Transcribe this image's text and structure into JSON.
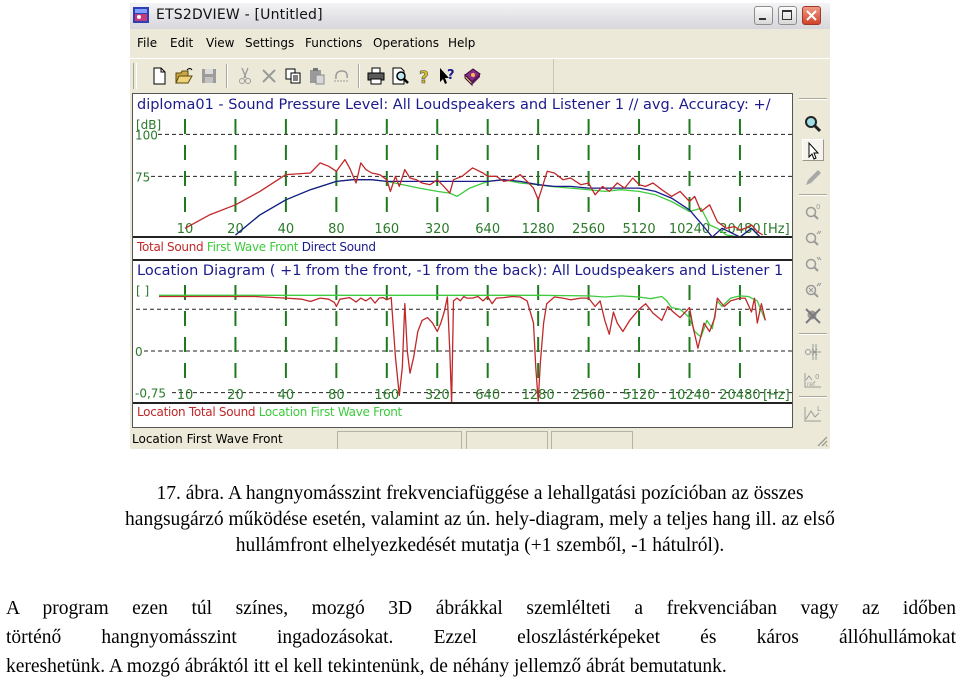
{
  "window": {
    "title": "ETS2DVIEW - [Untitled]",
    "icon": "ets-app-icon",
    "controls": [
      "minimize",
      "maximize",
      "close"
    ]
  },
  "menu": {
    "items": [
      "File",
      "Edit",
      "View",
      "Settings",
      "Functions",
      "Operations",
      "Help"
    ]
  },
  "toolbar": {
    "buttons": [
      {
        "name": "new",
        "icon": "new-document-icon",
        "enabled": true
      },
      {
        "name": "open",
        "icon": "open-folder-icon",
        "enabled": true
      },
      {
        "name": "save",
        "icon": "save-disk-icon",
        "enabled": false
      },
      {
        "name": "cut",
        "icon": "scissors-icon",
        "enabled": false
      },
      {
        "name": "delete",
        "icon": "x-delete-icon",
        "enabled": false
      },
      {
        "name": "copy",
        "icon": "copy-icon",
        "enabled": true
      },
      {
        "name": "paste",
        "icon": "paste-icon",
        "enabled": false
      },
      {
        "name": "undo",
        "icon": "undo-icon",
        "enabled": false
      },
      {
        "name": "print",
        "icon": "printer-icon",
        "enabled": true
      },
      {
        "name": "print-preview",
        "icon": "print-preview-icon",
        "enabled": true
      },
      {
        "name": "help",
        "icon": "question-mark-icon",
        "enabled": true
      },
      {
        "name": "context-help",
        "icon": "whats-this-icon",
        "enabled": true
      },
      {
        "name": "book",
        "icon": "book-icon",
        "enabled": true
      }
    ]
  },
  "colors": {
    "total_sound": "#c0282a",
    "first_wave_front": "#3ecb3e",
    "direct_sound": "#1a1a8c",
    "grid": "#1f7a1f",
    "title_text": "#1b1b8c",
    "axis_text": "#2a7a2a"
  },
  "chart_data": [
    {
      "type": "line",
      "title": "diploma01 - Sound Pressure Level:  All Loudspeakers and Listener 1 // avg. Accuracy: +/",
      "ylabel": "[dB]",
      "xlabel": "[Hz]",
      "x_scale": "log2",
      "xlim": [
        7,
        30000
      ],
      "ylim": [
        40,
        108
      ],
      "yticks": [
        {
          "value": 100,
          "label": "100"
        },
        {
          "value": 75,
          "label": "75"
        }
      ],
      "xticks": [
        10,
        20,
        40,
        80,
        160,
        320,
        640,
        1280,
        2560,
        5120,
        10240,
        20480
      ],
      "xtick_labels": [
        "10",
        "20",
        "40",
        "80",
        "160",
        "320",
        "640",
        "1280",
        "2560",
        "5120",
        "10240",
        "20480"
      ],
      "grid": true,
      "legend": [
        "Total Sound",
        "First Wave Front",
        "Direct Sound"
      ],
      "legend_placement": "bottom-left",
      "series": [
        {
          "name": "Total Sound",
          "x": [
            10,
            14,
            20,
            28,
            40,
            56,
            64,
            72,
            80,
            90,
            96,
            105,
            112,
            120,
            130,
            145,
            160,
            168,
            180,
            190,
            205,
            220,
            240,
            260,
            290,
            320,
            350,
            380,
            400,
            450,
            520,
            600,
            640,
            720,
            800,
            900,
            1000,
            1100,
            1200,
            1280,
            1350,
            1450,
            1600,
            1800,
            2000,
            2300,
            2560,
            2800,
            3100,
            3400,
            3800,
            4200,
            4700,
            5120,
            5600,
            6200,
            7000,
            8000,
            9000,
            10240,
            11000,
            12000,
            13500,
            15000,
            17000,
            19000,
            20480,
            22000,
            24000,
            26000,
            28000
          ],
          "y": [
            44,
            52,
            58,
            66,
            76,
            77,
            83,
            81,
            78,
            85,
            80,
            71,
            83,
            79,
            77,
            76,
            73,
            66,
            75,
            69,
            79,
            74,
            73,
            71,
            70,
            73,
            69,
            65,
            73,
            75,
            80,
            77,
            75,
            75,
            72,
            73,
            76,
            72,
            68,
            61,
            68,
            78,
            77,
            73,
            74,
            70,
            71,
            64,
            69,
            66,
            71,
            68,
            74,
            70,
            69,
            71,
            67,
            63,
            66,
            60,
            63,
            54,
            58,
            48,
            44,
            45,
            43,
            44,
            46,
            42,
            40
          ]
        },
        {
          "name": "First Wave Front",
          "x": [
            20,
            28,
            40,
            56,
            80,
            100,
            130,
            160,
            200,
            250,
            320,
            380,
            420,
            500,
            640,
            800,
            1000,
            1280,
            1500,
            2000,
            2560,
            3200,
            4000,
            5120,
            6400,
            8000,
            10240,
            12000,
            13500,
            15000,
            17000,
            20480,
            24000,
            27000
          ],
          "y": [
            40,
            52,
            61,
            67,
            72,
            73,
            73,
            72,
            70,
            68,
            66,
            65,
            63,
            68,
            72,
            73,
            71,
            70,
            69,
            68,
            67,
            66,
            67,
            66,
            64,
            60,
            54,
            56,
            46,
            44,
            40,
            38,
            44,
            38
          ]
        },
        {
          "name": "Direct Sound",
          "x": [
            20,
            28,
            40,
            56,
            80,
            100,
            130,
            160,
            250,
            320,
            500,
            640,
            800,
            1000,
            1280,
            1600,
            2000,
            2560,
            3200,
            4000,
            5120,
            6400,
            8000,
            10240,
            12000,
            14000,
            16000,
            20480,
            24000,
            27000
          ],
          "y": [
            40,
            52,
            61,
            67,
            72,
            73,
            73,
            72,
            72,
            72,
            72,
            72,
            73,
            72,
            70,
            69,
            69,
            68,
            68,
            68,
            68,
            66,
            62,
            55,
            47,
            38,
            44,
            36,
            44,
            38
          ]
        }
      ]
    },
    {
      "type": "line",
      "title": "Location Diagram ( +1 from the front, -1 from the back):  All Loudspeakers and Listener 1",
      "ylabel": "[ ]",
      "xlabel": "[Hz]",
      "x_scale": "log2",
      "xlim": [
        7,
        30000
      ],
      "ylim": [
        -0.9,
        1.15
      ],
      "yticks": [
        {
          "value": 0.75,
          "label": ""
        },
        {
          "value": 0,
          "label": "0"
        },
        {
          "value": -0.75,
          "label": "-0,75"
        }
      ],
      "xticks": [
        10,
        20,
        40,
        80,
        160,
        320,
        640,
        1280,
        2560,
        5120,
        10240,
        20480
      ],
      "xtick_labels": [
        "10",
        "20",
        "40",
        "80",
        "160",
        "320",
        "640",
        "1280",
        "2560",
        "5120",
        "10240",
        "20480"
      ],
      "grid": true,
      "legend": [
        "Location Total Sound",
        "Location First Wave Front"
      ],
      "legend_placement": "bottom-left",
      "series": [
        {
          "name": "Location Total Sound",
          "x": [
            7,
            26,
            40,
            50,
            56,
            64,
            72,
            78,
            80,
            84,
            96,
            105,
            112,
            120,
            128,
            136,
            144,
            152,
            160,
            170,
            180,
            190,
            198,
            205,
            212,
            220,
            232,
            245,
            260,
            280,
            300,
            320,
            336,
            352,
            368,
            380,
            390,
            400,
            420,
            440,
            460,
            480,
            520,
            560,
            600,
            640,
            680,
            720,
            800,
            900,
            1000,
            1100,
            1200,
            1240,
            1280,
            1320,
            1380,
            1440,
            1600,
            1800,
            2000,
            2300,
            2560,
            2800,
            3000,
            3200,
            3400,
            3600,
            3800,
            4100,
            4500,
            5120,
            5600,
            6200,
            7000,
            7600,
            8200,
            9000,
            10240,
            10800,
            11500,
            12500,
            13500,
            14500,
            15000,
            16500,
            18000,
            20480,
            22000,
            24000,
            25000,
            26000,
            27500,
            29000
          ],
          "y": [
            0.98,
            0.98,
            0.95,
            0.93,
            0.89,
            0.95,
            0.93,
            0.87,
            0.8,
            0.93,
            0.96,
            0.88,
            0.95,
            0.9,
            0.96,
            0.86,
            0.95,
            0.96,
            0.92,
            0.96,
            -0.1,
            -0.8,
            -0.3,
            0.85,
            0.0,
            -0.4,
            -0.1,
            0.35,
            0.55,
            0.6,
            0.5,
            0.35,
            0.5,
            0.7,
            0.97,
            0.0,
            -0.95,
            0.9,
            0.95,
            0.9,
            0.98,
            0.95,
            0.95,
            0.98,
            0.9,
            0.98,
            0.85,
            0.95,
            0.96,
            0.98,
            0.97,
            0.9,
            0.5,
            -0.3,
            -0.9,
            -0.2,
            0.5,
            0.85,
            0.97,
            0.95,
            0.92,
            0.95,
            0.95,
            0.8,
            0.9,
            0.55,
            0.3,
            0.7,
            0.5,
            0.35,
            0.55,
            0.75,
            0.85,
            0.68,
            0.55,
            0.8,
            0.7,
            0.6,
            0.78,
            0.4,
            0.05,
            0.5,
            0.35,
            0.6,
            0.95,
            0.8,
            0.9,
            0.95,
            0.95,
            0.7,
            0.95,
            0.5,
            0.85,
            0.55
          ]
        },
        {
          "name": "Location First Wave Front",
          "x": [
            7,
            80,
            160,
            320,
            640,
            1280,
            2560,
            3200,
            4000,
            5120,
            6000,
            7000,
            7500,
            8000,
            9000,
            10240,
            11000,
            12000,
            13000,
            14000,
            15000,
            16000,
            18000,
            20480,
            23000,
            26000,
            29000
          ],
          "y": [
            1.0,
            1.0,
            1.0,
            1.0,
            1.0,
            1.0,
            0.99,
            0.97,
            0.99,
            0.97,
            0.94,
            0.98,
            0.9,
            0.78,
            0.75,
            0.6,
            0.35,
            0.25,
            0.55,
            0.4,
            0.9,
            0.8,
            0.95,
            0.99,
            0.98,
            0.9,
            0.55
          ]
        }
      ]
    }
  ],
  "right_toolbar": {
    "buttons": [
      {
        "name": "zoom",
        "icon": "magnifier-icon"
      },
      {
        "name": "select",
        "icon": "arrow-pointer-icon",
        "active": true
      },
      {
        "name": "pen",
        "icon": "pencil-icon"
      },
      {
        "name": "zoom-reset",
        "icon": "zoom-reset-icon"
      },
      {
        "name": "zoom-in-x",
        "icon": "zoom-in-x-icon"
      },
      {
        "name": "zoom-out-x",
        "icon": "zoom-out-x-icon"
      },
      {
        "name": "zoom-in-y",
        "icon": "zoom-in-y-icon"
      },
      {
        "name": "zoom-cancel",
        "icon": "zoom-cancel-icon"
      },
      {
        "name": "cursor-markers",
        "icon": "cursor-markers-icon"
      },
      {
        "name": "ref-level",
        "icon": "ref-level-icon"
      },
      {
        "name": "plot-style",
        "icon": "plot-style-icon"
      }
    ]
  },
  "statusbar": {
    "text": "Location First Wave Front",
    "panes": [
      "",
      "",
      ""
    ]
  },
  "caption": {
    "lines": [
      "17. ábra. A hangnyomásszint frekvenciafüggése a lehallgatási pozícióban az összes",
      "hangsugárzó működése esetén, valamint az ún. hely-diagram, mely a teljes hang ill. az első",
      "hullámfront elhelyezkedését mutatja (+1 szemből, -1 hátulról)."
    ]
  },
  "paragraph": {
    "lines": [
      "A program ezen túl színes, mozgó 3D ábrákkal szemlélteti a frekvenciában vagy az időben",
      "történő hangnyomásszint ingadozásokat. Ezzel eloszlástérképeket és káros állóhullámokat",
      "kereshetünk. A mozgó ábráktól itt el kell tekintenünk, de néhány jellemző ábrát bemutatunk."
    ]
  }
}
